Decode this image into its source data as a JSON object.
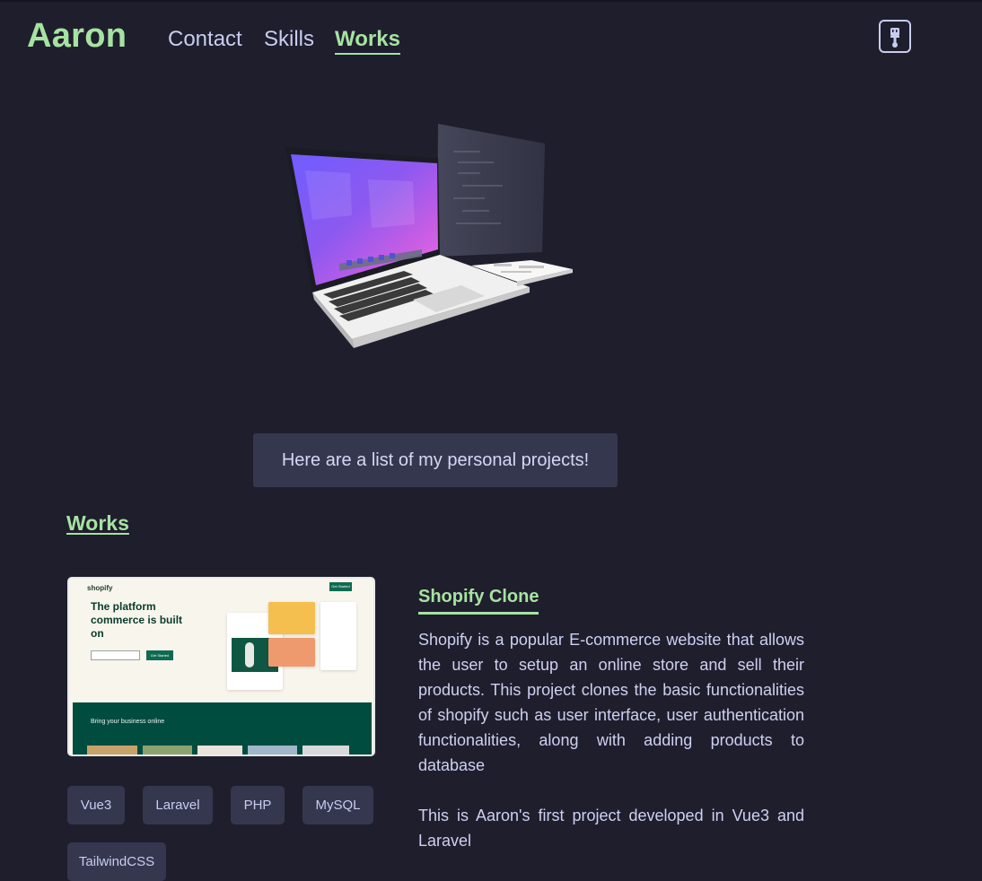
{
  "nav": {
    "brand": "Aaron",
    "links": [
      {
        "label": "Contact",
        "active": false
      },
      {
        "label": "Skills",
        "active": false
      },
      {
        "label": "Works",
        "active": true
      }
    ],
    "theme_icon": "paintbrush-icon"
  },
  "hero": {
    "illustration": "laptop-3d-illustration",
    "intro_text": "Here are a list of my personal projects!"
  },
  "works": {
    "heading": "Works",
    "projects": [
      {
        "title": "Shopify Clone",
        "description": "Shopify is a popular E-commerce website that allows the user to setup an online store and sell their products. This project clones the basic functionalities of shopify such as user interface, user authentication functionalities, along with adding products to database",
        "note": "This is Aaron's first project developed in Vue3 and Laravel",
        "tags": [
          "Vue3",
          "Laravel",
          "PHP",
          "MySQL",
          "TailwindCSS"
        ],
        "preview": {
          "logo": "shopify",
          "headline": "The platform commerce is built on",
          "cta": "Get Started",
          "band_title": "Bring your business online"
        }
      }
    ]
  },
  "colors": {
    "background": "#1f1e2d",
    "accent": "#a6e3a1",
    "text": "#cdd1f1",
    "surface": "#35374f"
  }
}
